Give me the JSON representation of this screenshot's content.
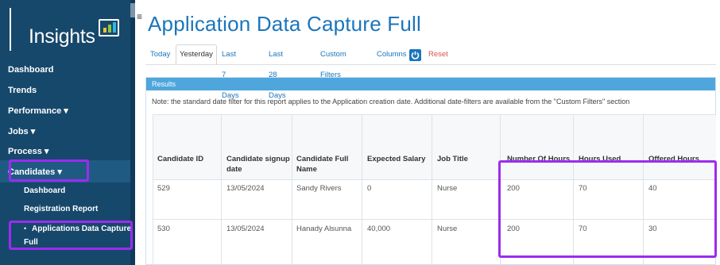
{
  "brand": {
    "logo_text": "Insights"
  },
  "sidebar": {
    "items": [
      {
        "label": "Dashboard"
      },
      {
        "label": "Trends"
      },
      {
        "label": "Performance ▾"
      },
      {
        "label": "Jobs ▾"
      },
      {
        "label": "Process ▾"
      },
      {
        "label": "Candidates ▾"
      }
    ],
    "subitems": [
      {
        "label": "Dashboard"
      },
      {
        "label": "Registration Report"
      },
      {
        "label": "Applications Data Capture"
      },
      {
        "label": "Full"
      }
    ]
  },
  "page": {
    "title": "Application Data Capture Full"
  },
  "tabs": {
    "today": "Today",
    "yesterday": "Yesterday",
    "last7": "Last 7 Days",
    "last28": "Last 28 Days",
    "custom": "Custom Filters",
    "columns": "Columns",
    "reset": "Reset"
  },
  "results": {
    "header": "Results",
    "note": "Note: the standard date filter for this report applies to the Application creation date. Additional date-filters are available from the \"Custom Filters\" section"
  },
  "table": {
    "columns": [
      {
        "line1": "",
        "line2": "Candidate ID"
      },
      {
        "line1": "Candidate signup",
        "line2": "date"
      },
      {
        "line1": "Candidate Full",
        "line2": "Name"
      },
      {
        "line1": "",
        "line2": "Expected Salary"
      },
      {
        "line1": "",
        "line2": "Job Title"
      },
      {
        "line1": "",
        "line2": "Number Of Hours"
      },
      {
        "line1": "",
        "line2": "Hours Used"
      },
      {
        "line1": "",
        "line2": "Offered Hours"
      }
    ],
    "rows": [
      [
        "529",
        "13/05/2024",
        "Sandy Rivers",
        "0",
        "Nurse",
        "200",
        "70",
        "40"
      ],
      [
        "530",
        "13/05/2024",
        "Hanady Alsunna",
        "40,000",
        "Nurse",
        "200",
        "70",
        "30"
      ]
    ]
  },
  "colors": {
    "sidebar": "#16486b",
    "title": "#1b75bb",
    "results_header": "#4ea6dc",
    "highlight": "#9b2cf0",
    "reset": "#d9534f"
  },
  "icons": [
    "menu-icon",
    "insights-chart-icon",
    "power-icon"
  ]
}
